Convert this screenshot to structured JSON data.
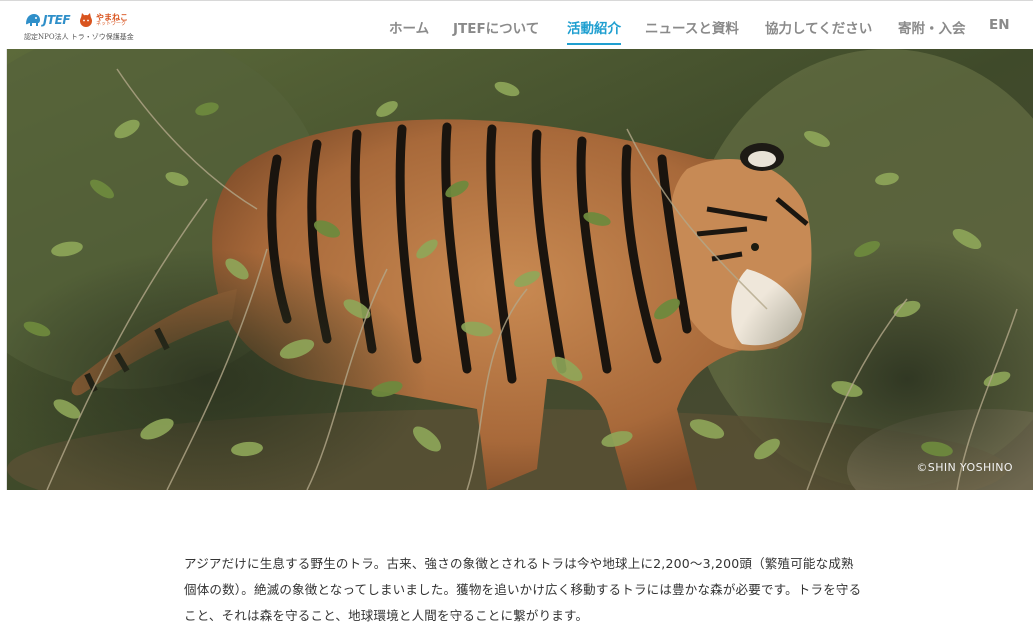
{
  "header": {
    "logo_jtef_text": "JTEF",
    "logo_partner_text": "やまねこ",
    "logo_partner_sub": "ネットワーク",
    "logo_subtitle": "認定NPO法人 トラ・ゾウ保護基金",
    "nav": [
      {
        "label": "ホーム",
        "active": false
      },
      {
        "label": "JTEFについて",
        "active": false
      },
      {
        "label": "活動紹介",
        "active": true
      },
      {
        "label": "ニュースと資料",
        "active": false
      },
      {
        "label": "協力してください",
        "active": false
      },
      {
        "label": "寄附・入会",
        "active": false
      },
      {
        "label": "EN",
        "active": false
      }
    ],
    "accent_color": "#1f9fd0",
    "nav_color": "#8a8a8a"
  },
  "hero": {
    "photo_subject": "tiger-in-forest",
    "credit": "©SHIN YOSHINO"
  },
  "intro": {
    "text": "アジアだけに生息する野生のトラ。古来、強さの象徴とされるトラは今や地球上に2,200〜3,200頭（繁殖可能な成熟個体の数）。絶滅の象徴となってしまいました。獲物を追いかけ広く移動するトラには豊かな森が必要です。トラを守ること、それは森を守ること、地球環境と人間を守ることに繋がります。"
  }
}
